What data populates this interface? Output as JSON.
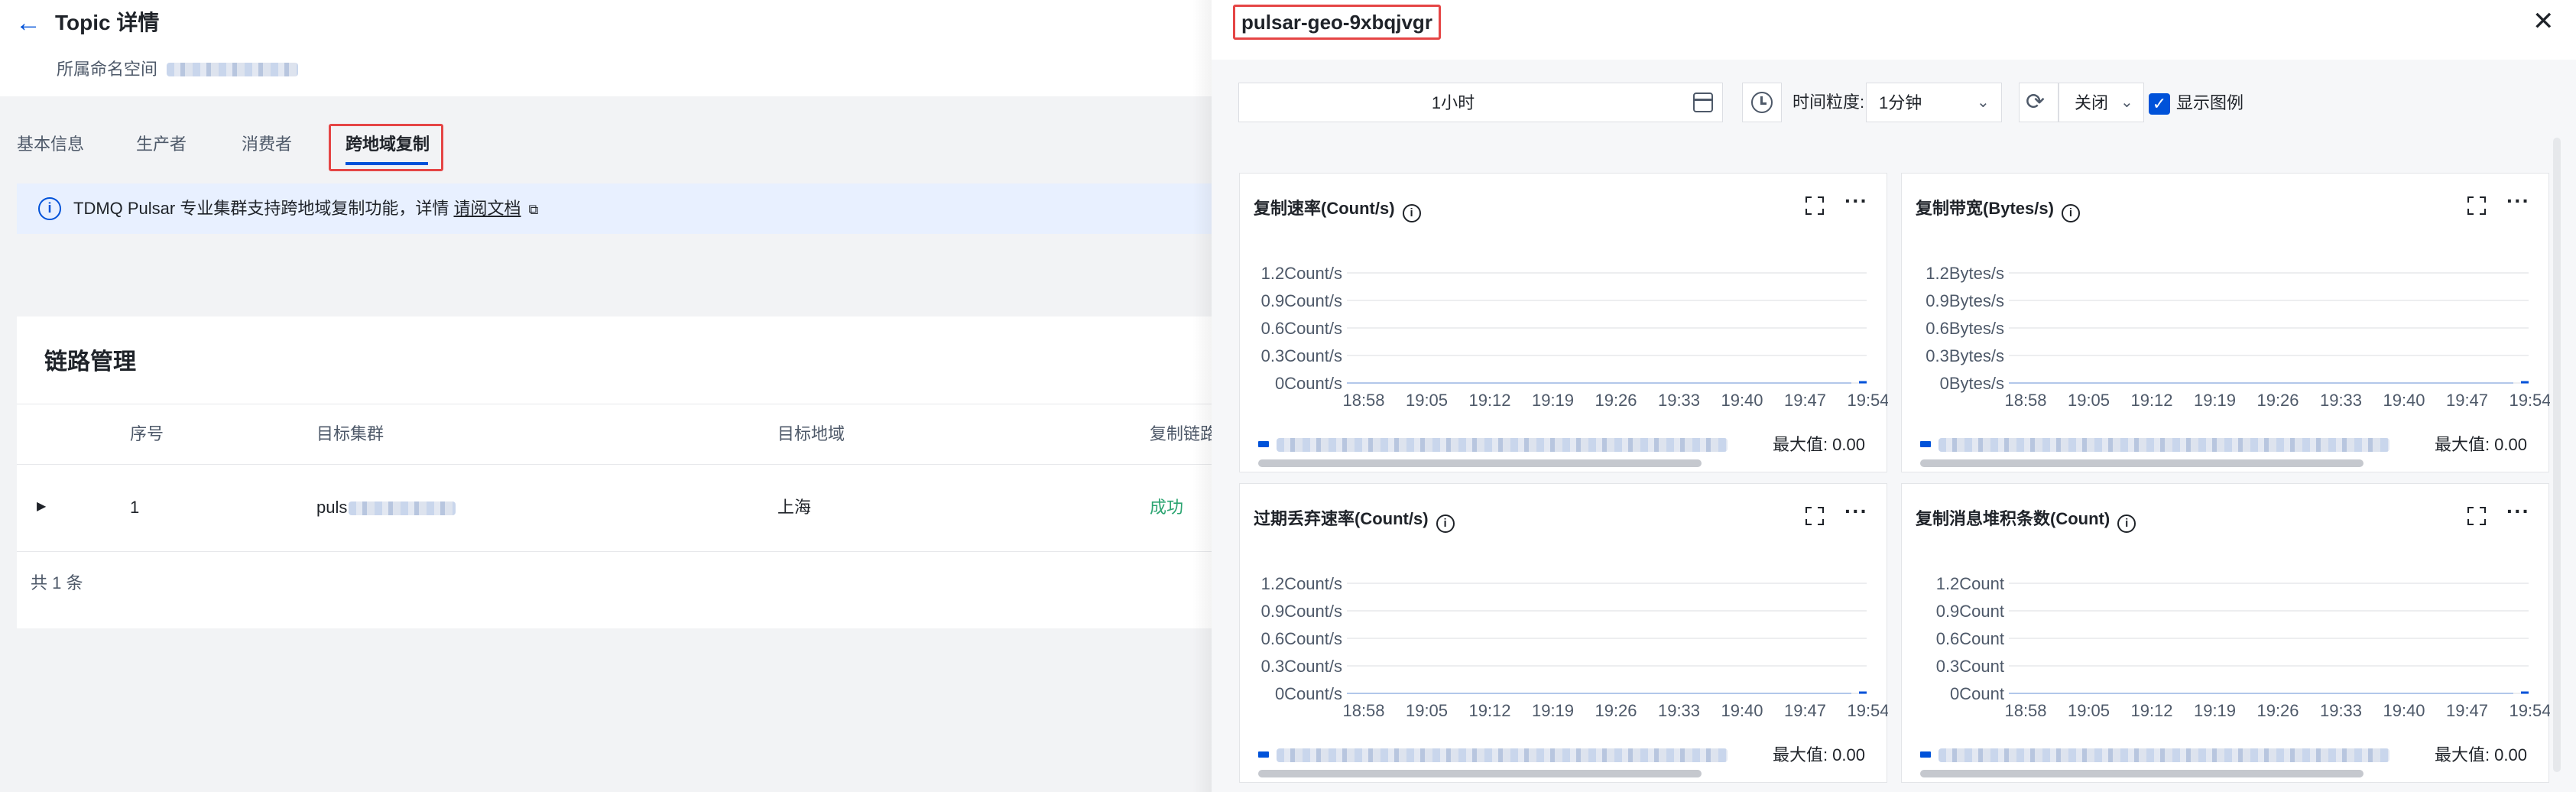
{
  "page": {
    "back_icon": "arrow-left-icon",
    "title": "Topic 详情",
    "namespace_label": "所属命名空间"
  },
  "tabs": [
    {
      "label": "基本信息",
      "active": false
    },
    {
      "label": "生产者",
      "active": false
    },
    {
      "label": "消费者",
      "active": false
    },
    {
      "label": "跨地域复制",
      "active": true
    }
  ],
  "notice": {
    "icon": "info-icon",
    "text": "TDMQ Pulsar 专业集群支持跨地域复制功能，详情",
    "link_text": "请阅文档",
    "link_icon": "external-link-icon",
    "bg_color": "#e8f0ff"
  },
  "links_card": {
    "title": "链路管理",
    "columns": [
      "序号",
      "目标集群",
      "目标地域",
      "复制链路"
    ],
    "rows": [
      {
        "index": "1",
        "cluster": "puls",
        "region": "上海",
        "status": "成功",
        "status_color": "#2ba471"
      }
    ],
    "total": "共 1 条"
  },
  "drawer": {
    "title": "pulsar-geo-9xbqjvgr",
    "close_icon": "close-icon",
    "toolbar": {
      "time_range": "1小时",
      "calendar_icon": "calendar-icon",
      "clock_icon": "clock-icon",
      "granularity_label": "时间粒度:",
      "granularity_value": "1分钟",
      "refresh_icon": "refresh-icon",
      "auto_refresh_value": "关闭",
      "show_legend_label": "显示图例",
      "show_legend_checked": true
    },
    "max_label": "最大值: 0.00",
    "accent_color": "#0052d9"
  },
  "chart_data": [
    {
      "type": "line",
      "title": "复制速率(Count/s)",
      "x": [
        "18:58",
        "19:05",
        "19:12",
        "19:19",
        "19:26",
        "19:33",
        "19:40",
        "19:47",
        "19:54"
      ],
      "y_ticks": [
        "1.2Count/s",
        "0.9Count/s",
        "0.6Count/s",
        "0.3Count/s",
        "0Count/s"
      ],
      "ylim": [
        0,
        1.2
      ],
      "series": [
        {
          "values": [
            0,
            0,
            0,
            0,
            0,
            0,
            0,
            0,
            0
          ]
        }
      ],
      "max": "0.00"
    },
    {
      "type": "line",
      "title": "复制带宽(Bytes/s)",
      "x": [
        "18:58",
        "19:05",
        "19:12",
        "19:19",
        "19:26",
        "19:33",
        "19:40",
        "19:47",
        "19:54"
      ],
      "y_ticks": [
        "1.2Bytes/s",
        "0.9Bytes/s",
        "0.6Bytes/s",
        "0.3Bytes/s",
        "0Bytes/s"
      ],
      "ylim": [
        0,
        1.2
      ],
      "series": [
        {
          "values": [
            0,
            0,
            0,
            0,
            0,
            0,
            0,
            0,
            0
          ]
        }
      ],
      "max": "0.00"
    },
    {
      "type": "line",
      "title": "过期丢弃速率(Count/s)",
      "x": [
        "18:58",
        "19:05",
        "19:12",
        "19:19",
        "19:26",
        "19:33",
        "19:40",
        "19:47",
        "19:54"
      ],
      "y_ticks": [
        "1.2Count/s",
        "0.9Count/s",
        "0.6Count/s",
        "0.3Count/s",
        "0Count/s"
      ],
      "ylim": [
        0,
        1.2
      ],
      "series": [
        {
          "values": [
            0,
            0,
            0,
            0,
            0,
            0,
            0,
            0,
            0
          ]
        }
      ],
      "max": "0.00"
    },
    {
      "type": "line",
      "title": "复制消息堆积条数(Count)",
      "x": [
        "18:58",
        "19:05",
        "19:12",
        "19:19",
        "19:26",
        "19:33",
        "19:40",
        "19:47",
        "19:54"
      ],
      "y_ticks": [
        "1.2Count",
        "0.9Count",
        "0.6Count",
        "0.3Count",
        "0Count"
      ],
      "ylim": [
        0,
        1.2
      ],
      "series": [
        {
          "values": [
            0,
            0,
            0,
            0,
            0,
            0,
            0,
            0,
            0
          ]
        }
      ],
      "max": "0.00"
    }
  ]
}
